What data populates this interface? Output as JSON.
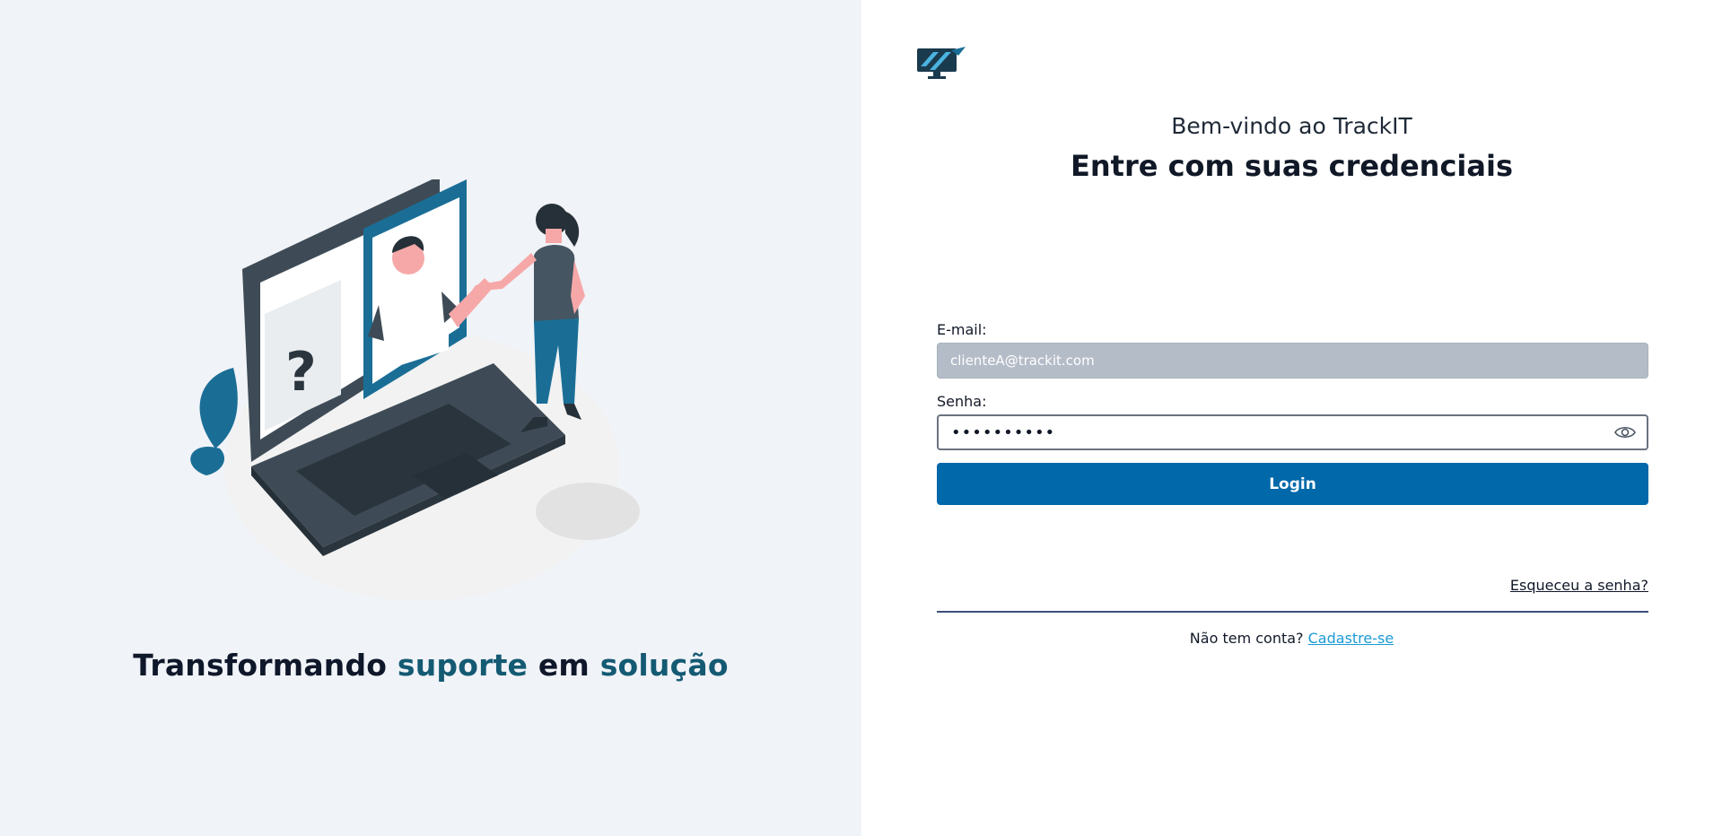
{
  "hero": {
    "tagline_part1": "Transformando ",
    "tagline_part2": "suporte",
    "tagline_part3": " em ",
    "tagline_part4": "solução"
  },
  "header": {
    "welcome": "Bem-vindo ao TrackIT",
    "heading": "Entre com suas credenciais"
  },
  "form": {
    "email_label": "E-mail:",
    "email_value": "clienteA@trackit.com",
    "password_label": "Senha:",
    "password_value": "••••••••••",
    "login_label": "Login",
    "forgot_label": "Esqueceu a senha?"
  },
  "signup": {
    "prompt": "Não tem conta? ",
    "link": "Cadastre-se"
  },
  "colors": {
    "primary": "#0168a9",
    "accent_text": "#145a73",
    "link": "#1b9ad6",
    "left_bg": "#f0f3f7"
  },
  "icons": [
    "trackit-logo-icon",
    "eye-icon"
  ]
}
